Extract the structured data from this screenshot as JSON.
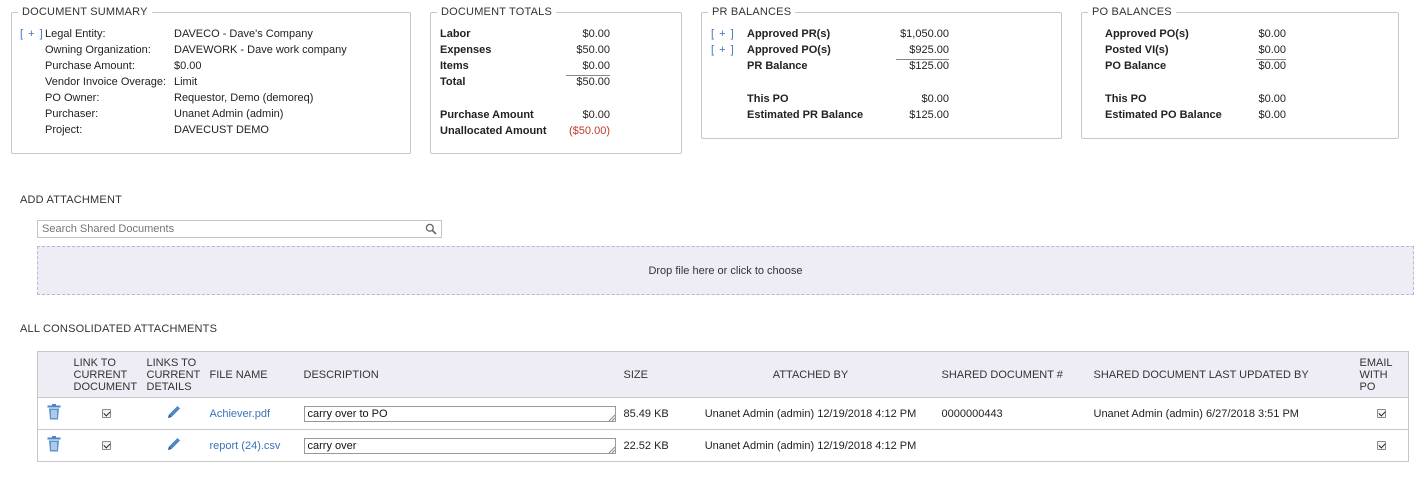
{
  "document_summary": {
    "title": "DOCUMENT SUMMARY",
    "expand_label": "[ + ]",
    "rows": [
      {
        "label": "Legal Entity:",
        "value": "DAVECO - Dave's Company"
      },
      {
        "label": "Owning Organization:",
        "value": "DAVEWORK - Dave work company"
      },
      {
        "label": "Purchase Amount:",
        "value": "$0.00"
      },
      {
        "label": "Vendor Invoice Overage:",
        "value": "Limit"
      },
      {
        "label": "PO Owner:",
        "value": "Requestor, Demo (demoreq)"
      },
      {
        "label": "Purchaser:",
        "value": "Unanet Admin (admin)"
      },
      {
        "label": "Project:",
        "value": "DAVECUST DEMO"
      }
    ]
  },
  "document_totals": {
    "title": "DOCUMENT TOTALS",
    "labor": {
      "label": "Labor",
      "value": "$0.00"
    },
    "expenses": {
      "label": "Expenses",
      "value": "$50.00"
    },
    "items": {
      "label": "Items",
      "value": "$0.00"
    },
    "total": {
      "label": "Total",
      "value": "$50.00"
    },
    "purchase_amount": {
      "label": "Purchase Amount",
      "value": "$0.00"
    },
    "unallocated_amount": {
      "label": "Unallocated Amount",
      "value": "($50.00)"
    }
  },
  "pr_balances": {
    "title": "PR BALANCES",
    "expand_label": "[ + ]",
    "approved_prs": {
      "label": "Approved PR(s)",
      "value": "$1,050.00"
    },
    "approved_pos": {
      "label": "Approved PO(s)",
      "value": "$925.00"
    },
    "pr_balance": {
      "label": "PR Balance",
      "value": "$125.00"
    },
    "this_po": {
      "label": "This PO",
      "value": "$0.00"
    },
    "estimated_pr_balance": {
      "label": "Estimated PR Balance",
      "value": "$125.00"
    }
  },
  "po_balances": {
    "title": "PO BALANCES",
    "approved_pos": {
      "label": "Approved PO(s)",
      "value": "$0.00"
    },
    "posted_vis": {
      "label": "Posted VI(s)",
      "value": "$0.00"
    },
    "po_balance": {
      "label": "PO Balance",
      "value": "$0.00"
    },
    "this_po": {
      "label": "This PO",
      "value": "$0.00"
    },
    "estimated_po_balance": {
      "label": "Estimated PO Balance",
      "value": "$0.00"
    }
  },
  "add_attachment": {
    "title": "ADD ATTACHMENT",
    "search_placeholder": "Search Shared Documents",
    "dropzone_text": "Drop file here or click to choose"
  },
  "attachments": {
    "title": "ALL CONSOLIDATED ATTACHMENTS",
    "headers": {
      "link_current_document": [
        "LINK TO",
        "CURRENT",
        "DOCUMENT"
      ],
      "links_current_details": [
        "LINKS TO",
        "CURRENT",
        "DETAILS"
      ],
      "file_name": "FILE NAME",
      "description": "DESCRIPTION",
      "size": "SIZE",
      "attached_by": "ATTACHED BY",
      "shared_doc_number": "SHARED DOCUMENT #",
      "shared_doc_last_updated_by": "SHARED DOCUMENT LAST UPDATED BY",
      "email_with_po": [
        "EMAIL",
        "WITH",
        "PO"
      ]
    },
    "rows": [
      {
        "link_current_document": true,
        "file_name": "Achiever.pdf",
        "description": "carry over to PO",
        "size": "85.49 KB",
        "attached_by": "Unanet Admin (admin) 12/19/2018 4:12 PM",
        "shared_doc_number": "0000000443",
        "shared_doc_last_updated_by": "Unanet Admin (admin) 6/27/2018 3:51 PM",
        "email_with_po": true
      },
      {
        "link_current_document": true,
        "file_name": "report (24).csv",
        "description": "carry over",
        "size": "22.52 KB",
        "attached_by": "Unanet Admin (admin) 12/19/2018 4:12 PM",
        "shared_doc_number": "",
        "shared_doc_last_updated_by": "",
        "email_with_po": true
      }
    ]
  },
  "icons": {
    "delete": "trash-icon",
    "edit": "pencil-icon",
    "search": "magnifier-icon"
  },
  "colors": {
    "link": "#3b73b9",
    "negative": "#c0392b",
    "header_bg": "#eeedf6"
  }
}
